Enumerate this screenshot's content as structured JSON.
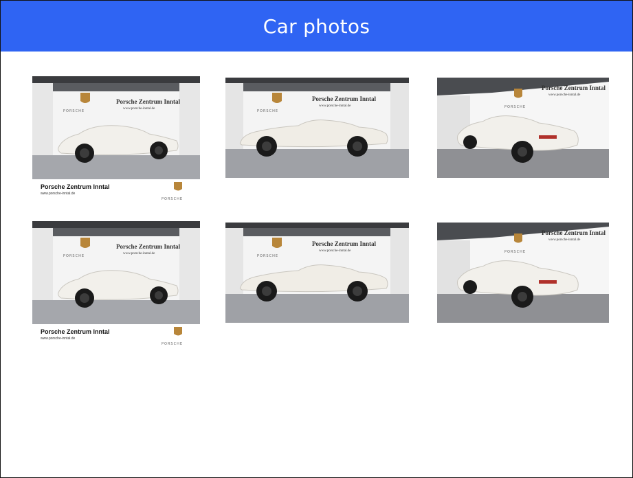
{
  "page": {
    "title": "Car photos"
  },
  "photos": [
    {
      "dealer": "Porsche Zentrum Inntal",
      "url": "www.porsche-inntal.de",
      "brand": "PORSCHE",
      "caption_title": "Porsche Zentrum Inntal",
      "caption_url": "www.porsche-inntal.de",
      "caption_brand": "PORSCHE"
    },
    {
      "dealer": "Porsche Zentrum Inntal",
      "url": "www.porsche-inntal.de",
      "brand": "PORSCHE"
    },
    {
      "dealer": "Porsche Zentrum Inntal",
      "url": "www.porsche-inntal.de",
      "brand": "PORSCHE"
    },
    {
      "dealer": "Porsche Zentrum Inntal",
      "url": "www.porsche-inntal.de",
      "brand": "PORSCHE",
      "caption_title": "Porsche Zentrum Inntal",
      "caption_url": "www.porsche-inntal.de",
      "caption_brand": "PORSCHE"
    },
    {
      "dealer": "Porsche Zentrum Inntal",
      "url": "www.porsche-inntal.de",
      "brand": "PORSCHE"
    },
    {
      "dealer": "Porsche Zentrum Inntal",
      "url": "www.porsche-inntal.de",
      "brand": "PORSCHE"
    }
  ],
  "colors": {
    "header": "#2f64f3",
    "car": "#f2f0eb",
    "floor": "#8f9094",
    "wall": "#f6f6f6"
  }
}
